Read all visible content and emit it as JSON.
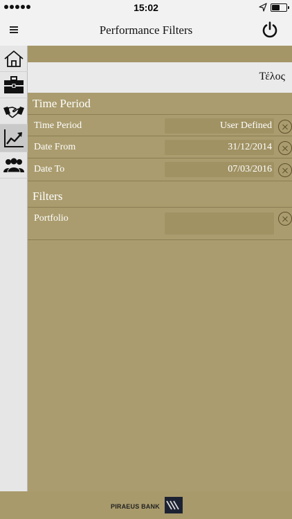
{
  "status_bar": {
    "time": "15:02",
    "battery_level": 0.55
  },
  "nav": {
    "title": "Performance Filters"
  },
  "sidebar": {
    "items": [
      {
        "name": "home",
        "icon": "home-icon",
        "active": false
      },
      {
        "name": "portfolio",
        "icon": "briefcase-icon",
        "active": false
      },
      {
        "name": "deals",
        "icon": "handshake-icon",
        "active": false
      },
      {
        "name": "performance",
        "icon": "chart-trend-icon",
        "active": true
      },
      {
        "name": "clients",
        "icon": "people-icon",
        "active": false
      }
    ]
  },
  "toolbar": {
    "done_label": "Τέλος"
  },
  "time_period": {
    "title": "Time Period",
    "rows": [
      {
        "label": "Time Period",
        "value": "User Defined"
      },
      {
        "label": "Date From",
        "value": "31/12/2014"
      },
      {
        "label": "Date To",
        "value": "07/03/2016"
      }
    ]
  },
  "filters": {
    "title": "Filters",
    "rows": [
      {
        "label": "Portfolio",
        "value": ""
      }
    ]
  },
  "footer": {
    "bank_name": "PIRAEUS BANK"
  },
  "colors": {
    "accent": "#aa9c6e",
    "toolbar": "#f2f2f2",
    "field": "#a09263"
  }
}
